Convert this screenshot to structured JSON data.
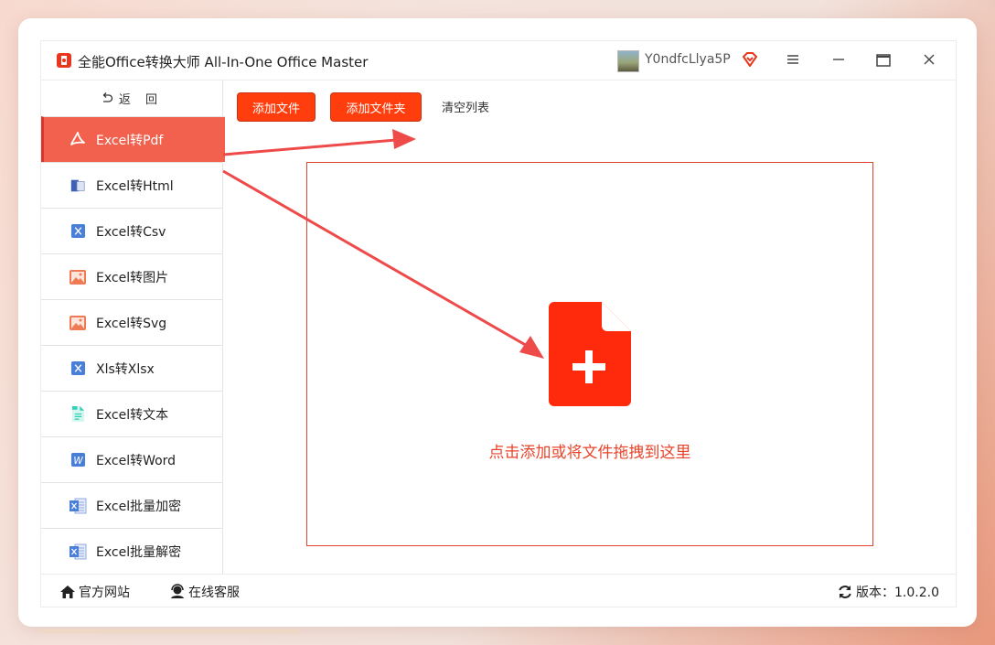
{
  "app": {
    "title": "全能Office转换大师 All-In-One Office Master",
    "user_name": "Y0ndfcLlya5P"
  },
  "sidebar": {
    "back_label": "返 回",
    "items": [
      {
        "label": "Excel转Pdf",
        "icon": "pdf-icon",
        "active": true
      },
      {
        "label": "Excel转Html",
        "icon": "html-icon"
      },
      {
        "label": "Excel转Csv",
        "icon": "excel-x-icon"
      },
      {
        "label": "Excel转图片",
        "icon": "image-icon"
      },
      {
        "label": "Excel转Svg",
        "icon": "image-icon"
      },
      {
        "label": "Xls转Xlsx",
        "icon": "excel-x-icon"
      },
      {
        "label": "Excel转文本",
        "icon": "text-file-icon"
      },
      {
        "label": "Excel转Word",
        "icon": "word-icon"
      },
      {
        "label": "Excel批量加密",
        "icon": "excel-sheet-icon"
      },
      {
        "label": "Excel批量解密",
        "icon": "excel-sheet-icon"
      }
    ]
  },
  "toolbar": {
    "add_file": "添加文件",
    "add_folder": "添加文件夹",
    "clear_list": "清空列表"
  },
  "dropzone": {
    "text": "点击添加或将文件拖拽到这里"
  },
  "status": {
    "website": "官方网站",
    "support": "在线客服",
    "version": "版本：1.0.2.0"
  },
  "colors": {
    "accent": "#ff3d0d",
    "active_item": "#f1614d",
    "arrow": "#ef4a4a"
  }
}
